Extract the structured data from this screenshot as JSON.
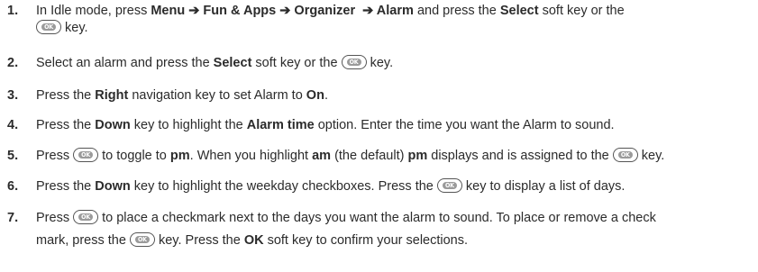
{
  "ok_icon_label": "OK",
  "steps": [
    {
      "num": "1.",
      "a": "In Idle mode, press ",
      "b1": "Menu ➔ Fun & Apps ➔ Organizer  ➔ Alarm",
      "a2": " and press the ",
      "b2": "Select",
      "a3": " soft key or the",
      "l2": " key."
    },
    {
      "num": "2.",
      "a": "Select an alarm and press the ",
      "b1": "Select",
      "a2": " soft key or the ",
      "a3": " key."
    },
    {
      "num": "3.",
      "a": "Press the ",
      "b1": "Right",
      "a2": " navigation key to set Alarm to ",
      "b2": "On",
      "a3": "."
    },
    {
      "num": "4.",
      "a": "Press the ",
      "b1": "Down",
      "a2": " key to highlight the ",
      "b2": "Alarm time",
      "a3": " option. Enter the time you want the Alarm to sound."
    },
    {
      "num": "5.",
      "a": "Press ",
      "a2": " to toggle to ",
      "b1": "pm",
      "a3": ". When you highlight ",
      "b2": "am",
      "a4": " (the default) ",
      "b3": "pm",
      "a5": " displays and is assigned to the ",
      "a6": " key."
    },
    {
      "num": "6.",
      "a": "Press the ",
      "b1": "Down",
      "a2": " key to highlight the weekday checkboxes. Press the ",
      "a3": " key to display a list of days."
    },
    {
      "num": "7.",
      "a": "Press ",
      "a2": " to place a checkmark next to the days you want the alarm to sound. To place or remove a check",
      "l2a": "mark, press the ",
      "l2b": " key. Press the ",
      "l2bold": "OK",
      "l2c": " soft key to confirm your selections."
    }
  ]
}
